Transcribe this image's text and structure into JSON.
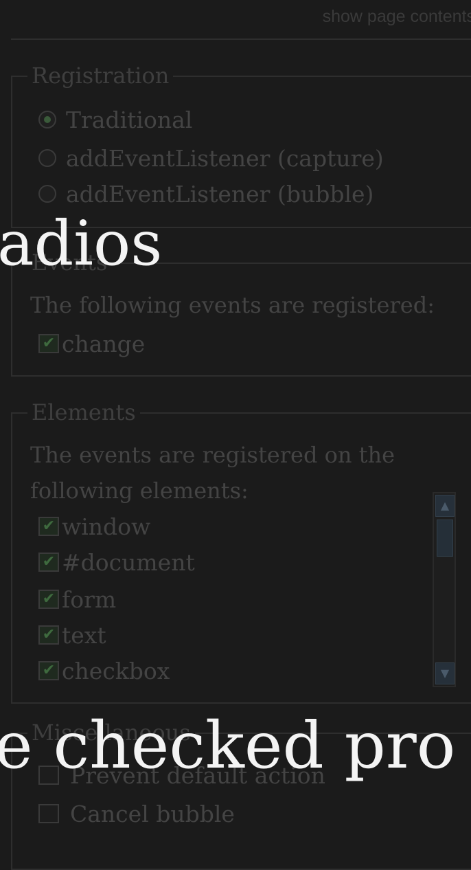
{
  "header": {
    "show_contents_link": "show page contents"
  },
  "registration": {
    "legend": "Registration",
    "options": [
      {
        "label": "Traditional",
        "selected": true
      },
      {
        "label": "addEventListener (capture)",
        "selected": false
      },
      {
        "label": "addEventListener (bubble)",
        "selected": false
      }
    ]
  },
  "events": {
    "legend": "Events",
    "description": "The following events are registered:",
    "items": [
      {
        "label": "change",
        "checked": true
      }
    ]
  },
  "elements": {
    "legend": "Elements",
    "description_line1": "The events are registered on the",
    "description_line2": "following elements:",
    "items": [
      {
        "label": "window",
        "checked": true
      },
      {
        "label": "#document",
        "checked": true
      },
      {
        "label": "form",
        "checked": true
      },
      {
        "label": "text",
        "checked": true
      },
      {
        "label": "checkbox",
        "checked": true
      }
    ]
  },
  "miscellaneous": {
    "legend": "Miscellaneous",
    "items": [
      {
        "label": "Prevent default action",
        "checked": false
      },
      {
        "label": "Cancel bubble",
        "checked": false
      }
    ]
  },
  "overlay": {
    "line1": "adios",
    "line2": "e checked pro"
  }
}
